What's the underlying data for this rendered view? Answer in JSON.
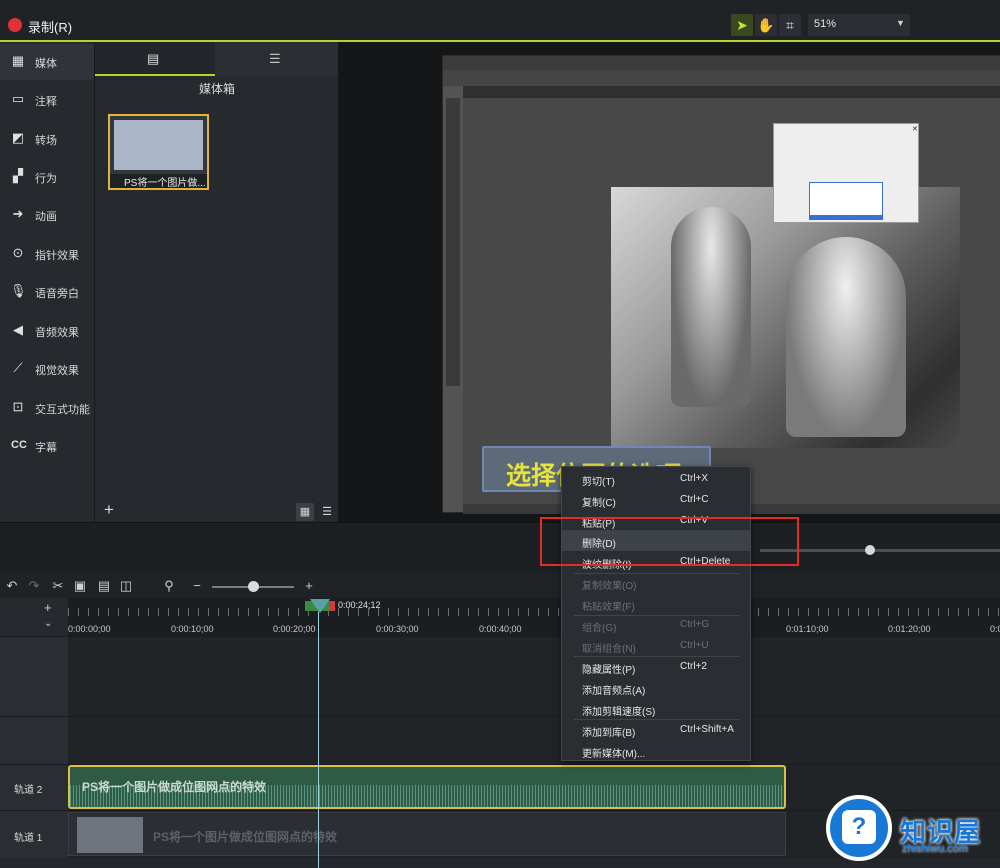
{
  "toolbar": {
    "record_label": "录制(R)",
    "zoom_value": "51%",
    "icons": [
      "arrow-select-icon",
      "hand-icon",
      "crop-icon"
    ]
  },
  "sidebar": {
    "items": [
      {
        "label": "媒体",
        "icon": "media-icon"
      },
      {
        "label": "注释",
        "icon": "annotation-icon"
      },
      {
        "label": "转场",
        "icon": "transition-icon"
      },
      {
        "label": "行为",
        "icon": "behavior-icon"
      },
      {
        "label": "动画",
        "icon": "animation-icon"
      },
      {
        "label": "指针效果",
        "icon": "cursor-effect-icon"
      },
      {
        "label": "语音旁白",
        "icon": "microphone-icon"
      },
      {
        "label": "音频效果",
        "icon": "speaker-icon"
      },
      {
        "label": "视觉效果",
        "icon": "magic-wand-icon"
      },
      {
        "label": "交互式功能",
        "icon": "interactive-icon"
      },
      {
        "label": "字幕",
        "icon": "cc-icon"
      }
    ]
  },
  "media_bin": {
    "title": "媒体箱",
    "thumb_caption": "PS将一个图片做..."
  },
  "caption_overlay": {
    "text": "选择位图的选项"
  },
  "timeline": {
    "playhead_time": "0:00:24;12",
    "ticks": [
      "0:00:00;00",
      "0:00:10;00",
      "0:00:20;00",
      "0:00:30;00",
      "0:00:40;00",
      "0:01:10;00",
      "0:01:20;00",
      "0:0"
    ],
    "tracks": [
      {
        "label": "轨道 2",
        "clip_title": "PS将一个图片做成位图网点的特效"
      },
      {
        "label": "轨道 1",
        "clip_title": "PS将一个图片做成位图网点的特效"
      }
    ]
  },
  "context_menu": {
    "items": [
      {
        "label": "剪切(T)",
        "shortcut": "Ctrl+X",
        "enabled": true
      },
      {
        "label": "复制(C)",
        "shortcut": "Ctrl+C",
        "enabled": true
      },
      {
        "label": "粘贴(P)",
        "shortcut": "Ctrl+V",
        "enabled": true
      },
      {
        "label": "删除(D)",
        "shortcut": "",
        "enabled": true,
        "highlighted": true
      },
      {
        "label": "波纹删除(I)",
        "shortcut": "Ctrl+Delete",
        "enabled": true
      },
      {
        "label": "复制效果(O)",
        "shortcut": "",
        "enabled": false
      },
      {
        "label": "粘贴效果(F)",
        "shortcut": "",
        "enabled": false
      },
      {
        "label": "组合(G)",
        "shortcut": "Ctrl+G",
        "enabled": false
      },
      {
        "label": "取消组合(N)",
        "shortcut": "Ctrl+U",
        "enabled": false
      },
      {
        "label": "隐藏属性(P)",
        "shortcut": "Ctrl+2",
        "enabled": true
      },
      {
        "label": "添加音频点(A)",
        "shortcut": "",
        "enabled": true
      },
      {
        "label": "添加剪辑速度(S)",
        "shortcut": "",
        "enabled": true
      },
      {
        "label": "添加到库(B)",
        "shortcut": "Ctrl+Shift+A",
        "enabled": true
      },
      {
        "label": "更新媒体(M)...",
        "shortcut": "",
        "enabled": true
      }
    ]
  },
  "watermark": {
    "brand": "知识屋",
    "domain": "zhishiwu.com"
  },
  "colors": {
    "accent": "#b8d22f",
    "record": "#e03232",
    "clip_border": "#d9c04a",
    "highlight_box": "#e52a2a",
    "caption_text": "#e6e33a",
    "watermark": "#1878d6"
  }
}
